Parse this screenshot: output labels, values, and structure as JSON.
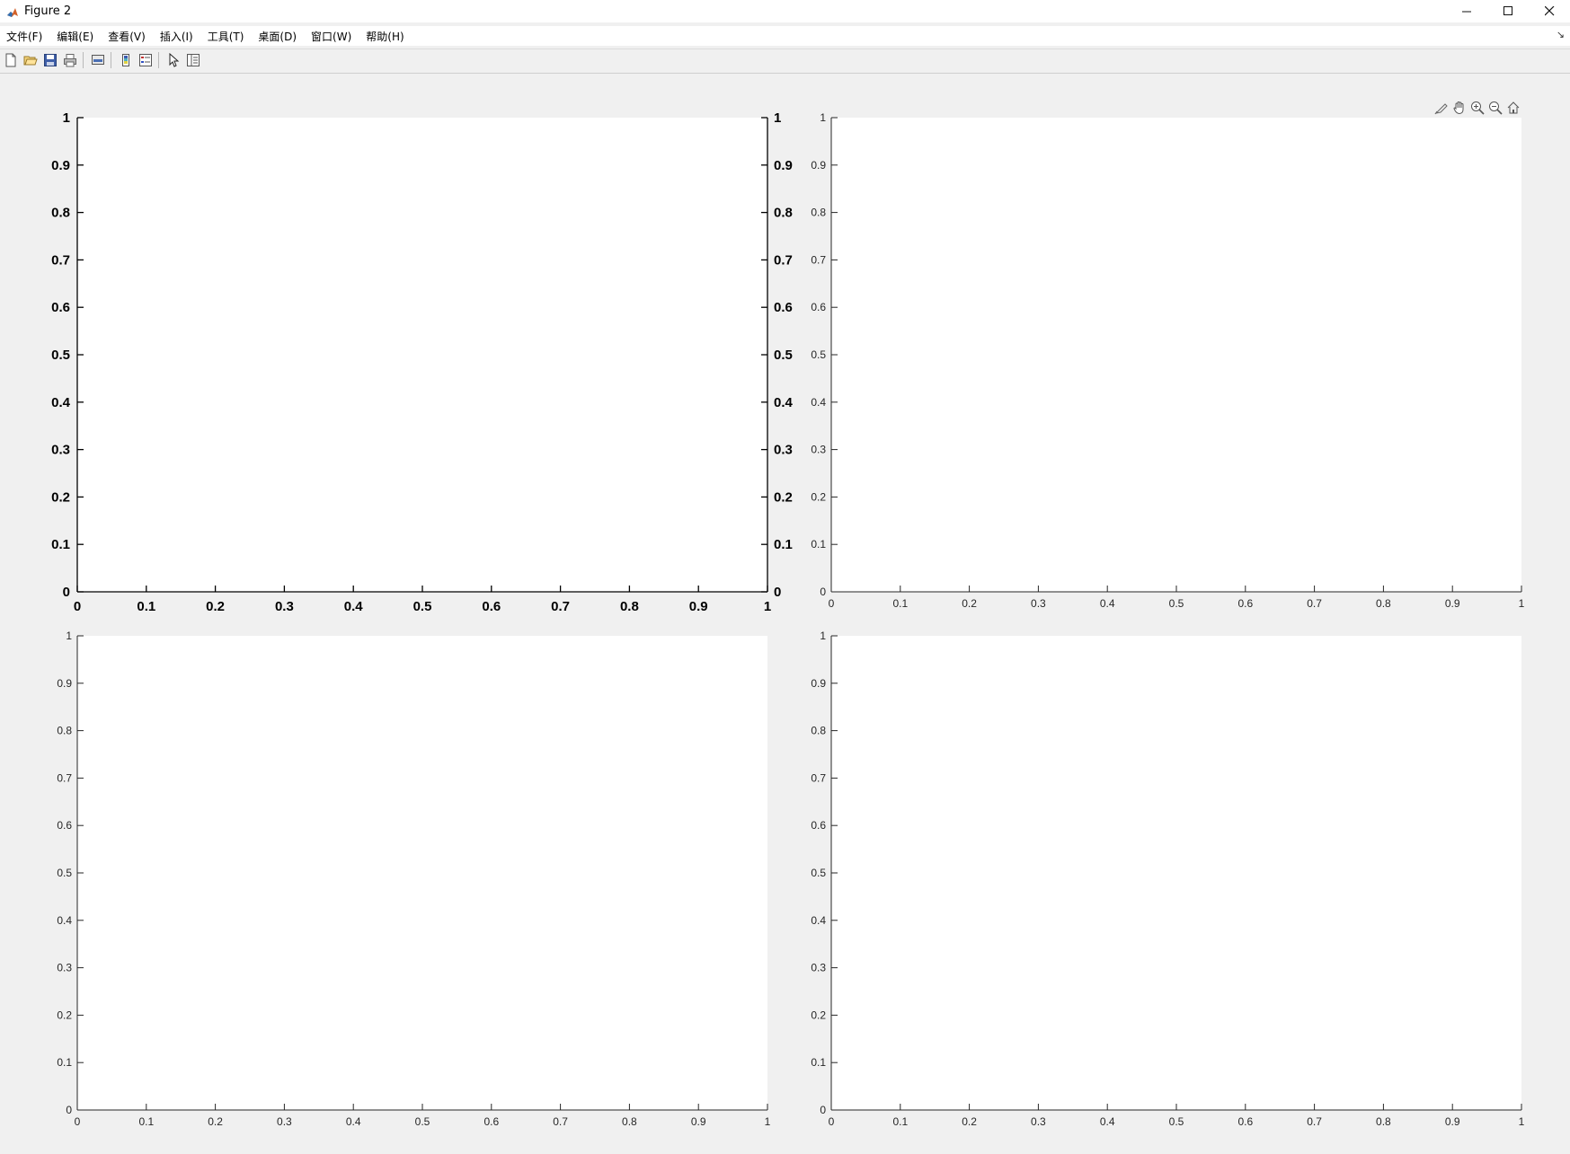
{
  "window": {
    "title": "Figure 2",
    "controls": {
      "minimize": "—",
      "maximize": "☐",
      "close": "✕"
    }
  },
  "menubar": {
    "items": [
      "文件(F)",
      "编辑(E)",
      "查看(V)",
      "插入(I)",
      "工具(T)",
      "桌面(D)",
      "窗口(W)",
      "帮助(H)"
    ],
    "overflow_icon": "dock-arrow-icon"
  },
  "toolbar": {
    "buttons": [
      "new-figure-icon",
      "open-file-icon",
      "save-icon",
      "print-icon",
      "link-plot-icon",
      "insert-colorbar-icon",
      "insert-legend-icon",
      "edit-plot-icon",
      "property-inspector-icon"
    ]
  },
  "axes_toolbar": {
    "buttons": [
      "brush-icon",
      "pan-icon",
      "zoom-in-icon",
      "zoom-out-icon",
      "home-icon"
    ]
  },
  "chart_data": [
    {
      "type": "scatter",
      "series": [],
      "xlim": [
        0,
        1
      ],
      "ylim": [
        0,
        1
      ],
      "xticks": [
        "0",
        "0.1",
        "0.2",
        "0.3",
        "0.4",
        "0.5",
        "0.6",
        "0.7",
        "0.8",
        "0.9",
        "1"
      ],
      "yticks": [
        "0",
        "0.1",
        "0.2",
        "0.3",
        "0.4",
        "0.5",
        "0.6",
        "0.7",
        "0.8",
        "0.9",
        "1"
      ],
      "yticks_right": [
        "0",
        "0.1",
        "0.2",
        "0.3",
        "0.4",
        "0.5",
        "0.6",
        "0.7",
        "0.8",
        "0.9",
        "1"
      ],
      "bold_ticks": true,
      "grid": false
    },
    {
      "type": "scatter",
      "series": [],
      "xlim": [
        0,
        1
      ],
      "ylim": [
        0,
        1
      ],
      "xticks": [
        "0",
        "0.1",
        "0.2",
        "0.3",
        "0.4",
        "0.5",
        "0.6",
        "0.7",
        "0.8",
        "0.9",
        "1"
      ],
      "yticks": [
        "0",
        "0.1",
        "0.2",
        "0.3",
        "0.4",
        "0.5",
        "0.6",
        "0.7",
        "0.8",
        "0.9",
        "1"
      ],
      "bold_ticks": false,
      "grid": false
    },
    {
      "type": "scatter",
      "series": [],
      "xlim": [
        0,
        1
      ],
      "ylim": [
        0,
        1
      ],
      "xticks": [
        "0",
        "0.1",
        "0.2",
        "0.3",
        "0.4",
        "0.5",
        "0.6",
        "0.7",
        "0.8",
        "0.9",
        "1"
      ],
      "yticks": [
        "0",
        "0.1",
        "0.2",
        "0.3",
        "0.4",
        "0.5",
        "0.6",
        "0.7",
        "0.8",
        "0.9",
        "1"
      ],
      "bold_ticks": false,
      "grid": false
    },
    {
      "type": "scatter",
      "series": [],
      "xlim": [
        0,
        1
      ],
      "ylim": [
        0,
        1
      ],
      "xticks": [
        "0",
        "0.1",
        "0.2",
        "0.3",
        "0.4",
        "0.5",
        "0.6",
        "0.7",
        "0.8",
        "0.9",
        "1"
      ],
      "yticks": [
        "0",
        "0.1",
        "0.2",
        "0.3",
        "0.4",
        "0.5",
        "0.6",
        "0.7",
        "0.8",
        "0.9",
        "1"
      ],
      "bold_ticks": false,
      "grid": false
    }
  ]
}
